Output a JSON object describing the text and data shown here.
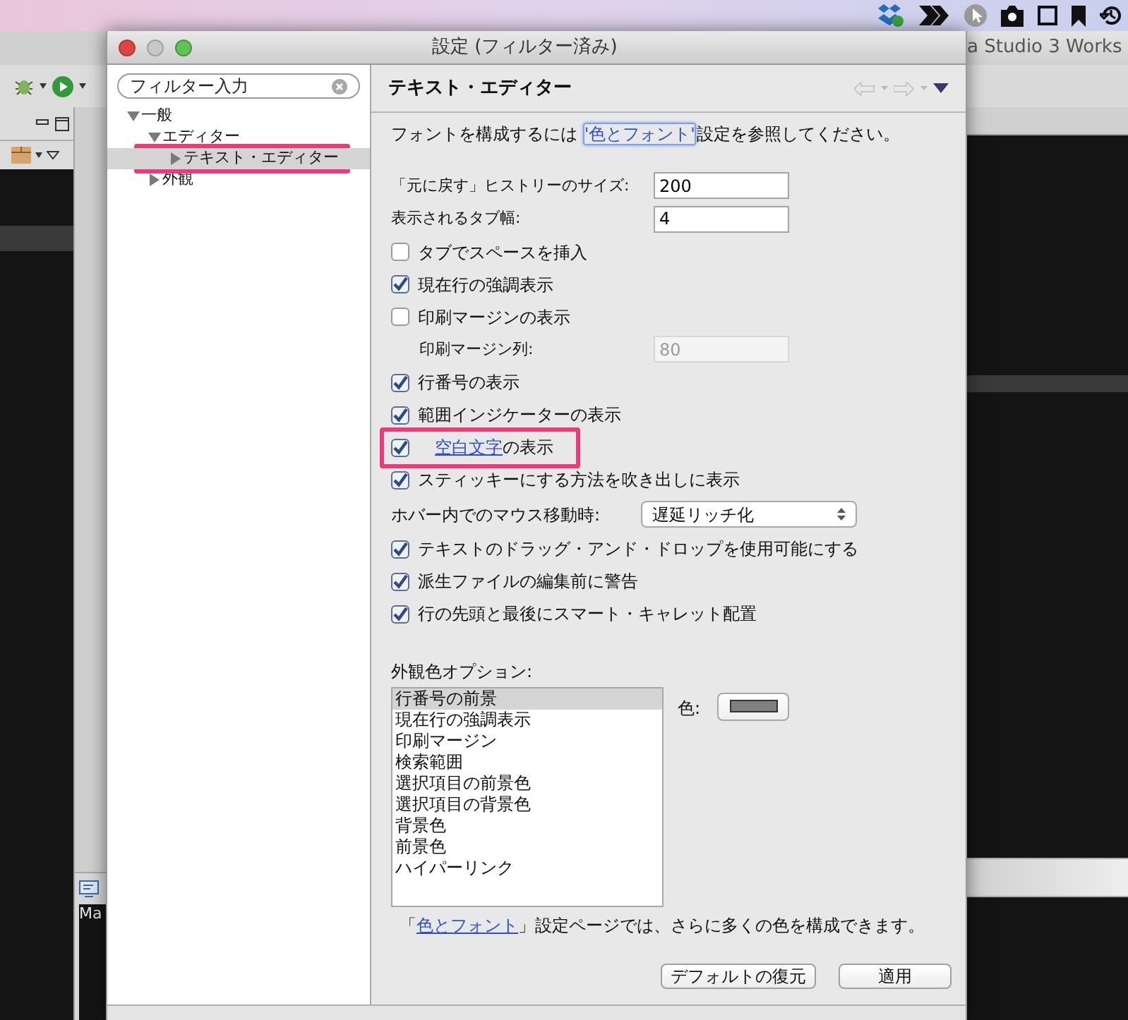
{
  "background": {
    "window_title": "a Studio 3 Works",
    "console_text": "Ma"
  },
  "dialog": {
    "title": "設定 (フィルター済み)"
  },
  "filter": {
    "placeholder": "フィルター入力"
  },
  "tree": [
    {
      "label": "一般",
      "expanded": true,
      "selected": false,
      "highlighted": false,
      "children": [
        {
          "label": "エディター",
          "expanded": true,
          "selected": false,
          "highlighted": false,
          "children": [
            {
              "label": "テキスト・エディター",
              "expanded": false,
              "selected": true,
              "highlighted": true
            }
          ]
        },
        {
          "label": "外観",
          "expanded": false,
          "selected": false,
          "highlighted": false
        }
      ]
    }
  ],
  "page": {
    "title": "テキスト・エディター",
    "intro": {
      "before": "フォントを構成するには ",
      "link": "'色とフォント'",
      "after": "設定を参照してください。"
    },
    "settings": [
      {
        "kind": "field",
        "label": "「元に戻す」ヒストリーのサイズ:",
        "value": "200",
        "disabled": false
      },
      {
        "kind": "field",
        "label": "表示されるタブ幅:",
        "value": "4",
        "disabled": false
      },
      {
        "kind": "checkbox",
        "label": "タブでスペースを挿入",
        "checked": false,
        "highlighted": false
      },
      {
        "kind": "checkbox",
        "label": "現在行の強調表示",
        "checked": true,
        "highlighted": false
      },
      {
        "kind": "checkbox",
        "label": "印刷マージンの表示",
        "checked": false,
        "highlighted": false
      },
      {
        "kind": "subfield",
        "label": "印刷マージン列:",
        "value": "80",
        "disabled": true
      },
      {
        "kind": "checkbox",
        "label": "行番号の表示",
        "checked": true,
        "highlighted": false
      },
      {
        "kind": "checkbox",
        "label": "範囲インジケーターの表示",
        "checked": true,
        "highlighted": false
      },
      {
        "kind": "checkbox",
        "link": "空白文字",
        "label": "の表示",
        "checked": true,
        "highlighted": true
      },
      {
        "kind": "checkbox",
        "label": "スティッキーにする方法を吹き出しに表示",
        "checked": true,
        "highlighted": false
      },
      {
        "kind": "select",
        "label": "ホバー内でのマウス移動時:",
        "value": "遅延リッチ化"
      },
      {
        "kind": "checkbox",
        "label": "テキストのドラッグ・アンド・ドロップを使用可能にする",
        "checked": true,
        "highlighted": false
      },
      {
        "kind": "checkbox",
        "label": "派生ファイルの編集前に警告",
        "checked": true,
        "highlighted": false
      },
      {
        "kind": "checkbox",
        "label": "行の先頭と最後にスマート・キャレット配置",
        "checked": true,
        "highlighted": false
      }
    ],
    "appearance": {
      "label": "外観色オプション:",
      "color_label": "色:",
      "items": [
        {
          "label": "行番号の前景",
          "selected": true
        },
        {
          "label": "現在行の強調表示",
          "selected": false
        },
        {
          "label": "印刷マージン",
          "selected": false
        },
        {
          "label": "検索範囲",
          "selected": false
        },
        {
          "label": "選択項目の前景色",
          "selected": false
        },
        {
          "label": "選択項目の背景色",
          "selected": false
        },
        {
          "label": "背景色",
          "selected": false
        },
        {
          "label": "前景色",
          "selected": false
        },
        {
          "label": "ハイパーリンク",
          "selected": false
        }
      ]
    },
    "footer": {
      "before": "「",
      "link": "色とフォント",
      "after": "」設定ページでは、さらに多くの色を構成できます。"
    },
    "buttons": [
      "デフォルトの復元",
      "適用"
    ]
  }
}
